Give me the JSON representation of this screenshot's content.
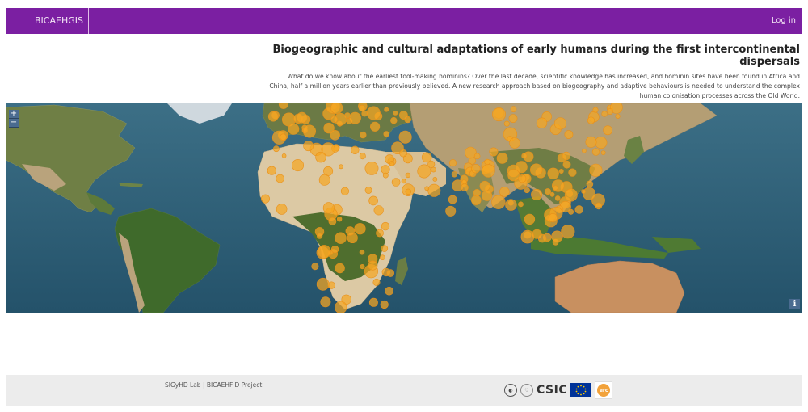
{
  "navbar": {
    "brand": "BICAEHGIS",
    "login": "Log in",
    "color": "#7b1fa2"
  },
  "intro": {
    "title": "Biogeographic and cultural adaptations of early humans during the first intercontinental dispersals",
    "text": "What do we know about the earliest tool-making hominins? Over the last decade, scientific knowledge has increased, and hominin sites have been found in Africa and China, half a million years earlier than previously believed. A new research approach based on biogeography and adaptive behaviours is needed to understand the complex human colonisation processes across the Old World."
  },
  "map": {
    "zoom_in": "+",
    "zoom_out": "−",
    "info": "i",
    "marker_color": "#f5a623"
  },
  "footer": {
    "text": "SIGyHD Lab | BICAEHFID Project",
    "logos": {
      "csic": "CSIC",
      "erc": "erc"
    }
  }
}
